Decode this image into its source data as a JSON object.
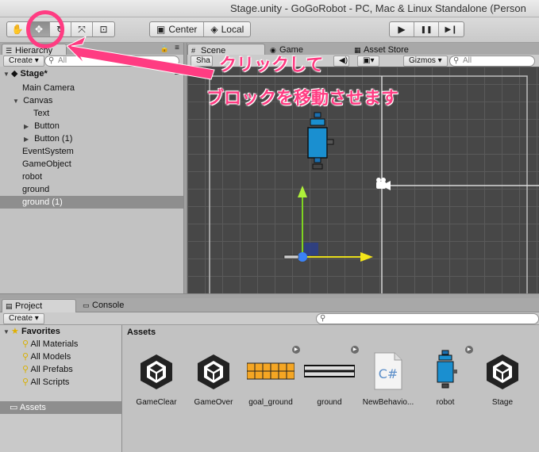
{
  "window": {
    "title": "Stage.unity - GoGoRobot - PC, Mac & Linux Standalone (Person"
  },
  "toolbar": {
    "tools": [
      {
        "name": "hand",
        "glyph": "✋"
      },
      {
        "name": "move",
        "glyph": "✥"
      },
      {
        "name": "rotate",
        "glyph": "↻"
      },
      {
        "name": "scale",
        "glyph": "⤧"
      },
      {
        "name": "rect",
        "glyph": "⊡"
      }
    ],
    "pivot_label": "Center",
    "space_label": "Local",
    "play_glyph": "▶",
    "pause_glyph": "❚❚",
    "step_glyph": "▶❙"
  },
  "hierarchy": {
    "tab_label": "Hierarchy",
    "create_label": "Create ▾",
    "search_placeholder": "All",
    "scene_name": "Stage*",
    "items": [
      {
        "label": "Main Camera",
        "indent": 1,
        "arrow": ""
      },
      {
        "label": "Canvas",
        "indent": 1,
        "arrow": "▼"
      },
      {
        "label": "Text",
        "indent": 2,
        "arrow": ""
      },
      {
        "label": "Button",
        "indent": 2,
        "arrow": "▶"
      },
      {
        "label": "Button (1)",
        "indent": 2,
        "arrow": "▶"
      },
      {
        "label": "EventSystem",
        "indent": 1,
        "arrow": ""
      },
      {
        "label": "GameObject",
        "indent": 1,
        "arrow": ""
      },
      {
        "label": "robot",
        "indent": 1,
        "arrow": ""
      },
      {
        "label": "ground",
        "indent": 1,
        "arrow": ""
      },
      {
        "label": "ground (1)",
        "indent": 1,
        "arrow": "",
        "selected": true
      }
    ]
  },
  "scene_tabs": {
    "scene": "Scene",
    "game": "Game",
    "asset_store": "Asset Store"
  },
  "scene_bar": {
    "shaded": "Sha",
    "gizmos": "Gizmos ▾",
    "search_placeholder": "All"
  },
  "annotation": {
    "line1": "クリックして",
    "line2": "ブロックを移動させます",
    "color": "#ff3c82"
  },
  "project": {
    "tab_label": "Project",
    "console_label": "Console",
    "create_label": "Create ▾",
    "favorites_label": "Favorites",
    "favorites": [
      "All Materials",
      "All Models",
      "All Prefabs",
      "All Scripts"
    ],
    "assets_folder": "Assets",
    "assets_header": "Assets",
    "assets": [
      {
        "label": "GameClear",
        "kind": "unity"
      },
      {
        "label": "GameOver",
        "kind": "unity"
      },
      {
        "label": "goal_ground",
        "kind": "goal"
      },
      {
        "label": "ground",
        "kind": "ground"
      },
      {
        "label": "NewBehavio...",
        "kind": "script"
      },
      {
        "label": "robot",
        "kind": "robot"
      },
      {
        "label": "Stage",
        "kind": "unity"
      }
    ]
  }
}
